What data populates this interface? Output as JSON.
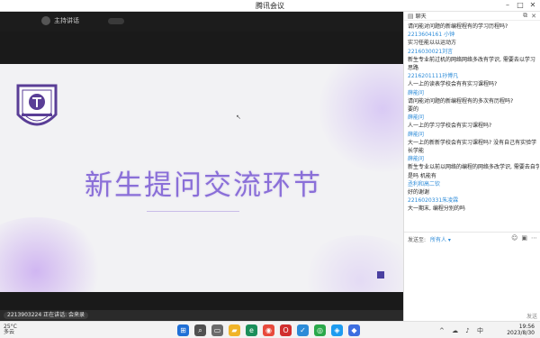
{
  "window": {
    "title": "腾讯会议"
  },
  "speaker": {
    "name": "主持讲话"
  },
  "slide": {
    "title": "新生提问交流环节"
  },
  "status": {
    "text": "2213903224 正在讲话: 会来录"
  },
  "sidebar": {
    "header": "聊天",
    "messages": [
      {
        "kind": "t",
        "text": "请问能对问题的新编程程有的学习历程吗?"
      },
      {
        "kind": "s",
        "text": "2213604161 小钟"
      },
      {
        "kind": "t",
        "text": "实习任能以以运动方"
      },
      {
        "kind": "s",
        "text": "2216030021刘言"
      },
      {
        "kind": "t",
        "text": "新生专业前过机的网络网络多改有学识, 需要去以学习"
      },
      {
        "kind": "t",
        "text": "思路"
      },
      {
        "kind": "s",
        "text": "2216201111孙博凡"
      },
      {
        "kind": "t",
        "text": "人一上的读表学校会有有实习课程吗?"
      },
      {
        "kind": "s",
        "text": "薛能问"
      },
      {
        "kind": "t",
        "text": "请问能对问题的新编程程有的多次有历程吗?"
      },
      {
        "kind": "t",
        "text": "要的"
      },
      {
        "kind": "s",
        "text": "薛能问"
      },
      {
        "kind": "t",
        "text": "人一上的学习学校会有实习课程吗?"
      },
      {
        "kind": "s",
        "text": "薛能问"
      },
      {
        "kind": "t",
        "text": "大一上的新新学校会有实习课程吗? 没有自己有实验学"
      },
      {
        "kind": "t",
        "text": "长学能"
      },
      {
        "kind": "s",
        "text": "薛能问"
      },
      {
        "kind": "t",
        "text": "新生专业以前以网络的编程的网络多改学识, 需要去自学较"
      },
      {
        "kind": "t",
        "text": "是吗  机能有"
      },
      {
        "kind": "s",
        "text": "丞利和高二钦"
      },
      {
        "kind": "t",
        "text": "好的谢谢"
      },
      {
        "kind": "s",
        "text": "2216020331朱凌霖"
      },
      {
        "kind": "t",
        "text": "大一期末, 编程分别的吗"
      }
    ],
    "send_to_label": "发送至:",
    "send_to_value": "所有人 ▾",
    "send_button": "发送"
  },
  "taskbar": {
    "weather": [
      "25°C",
      "多云"
    ],
    "clock": [
      "19:56",
      "2023/8/30"
    ]
  },
  "colors": {
    "accent": "#8a6fd8",
    "link": "#2c8bd8"
  }
}
